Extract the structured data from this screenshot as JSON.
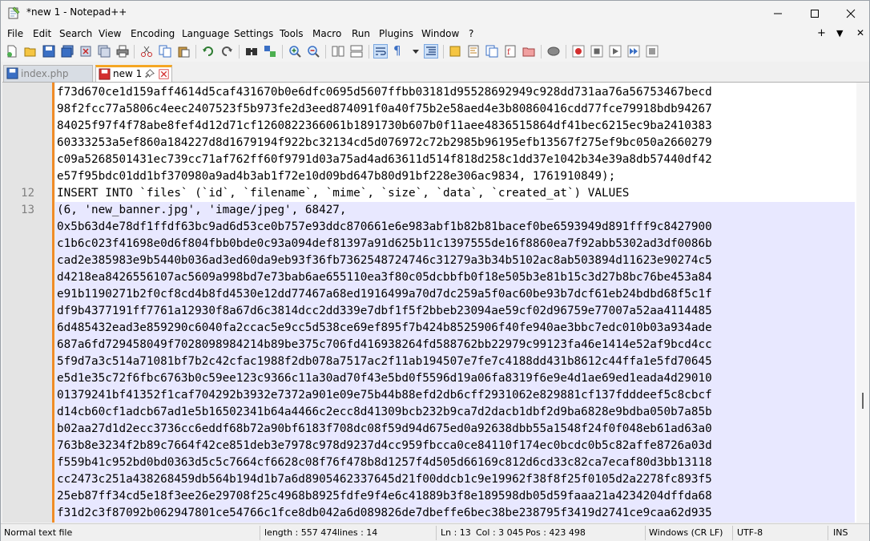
{
  "window": {
    "title": "*new 1 - Notepad++"
  },
  "menu": [
    "File",
    "Edit",
    "Search",
    "View",
    "Encoding",
    "Language",
    "Settings",
    "Tools",
    "Macro",
    "Run",
    "Plugins",
    "Window",
    "?"
  ],
  "menu_right": {
    "plus": "+",
    "down": "▼",
    "close": "✕"
  },
  "tabs": [
    {
      "label": "index.php"
    },
    {
      "label": "new 1"
    }
  ],
  "editor": {
    "lines": [
      "f73d670ce1d159aff4614d5caf431670b0e6dfc0695d5607ffbb03181d95528692949c928dd731aa76a56753467becd",
      "98f2fcc77a5806c4eec2407523f5b973fe2d3eed874091f0a40f75b2e58aed4e3b80860416cdd77fce79918bdb94267",
      "84025f97f4f78abe8fef4d12d71cf1260822366061b1891730b607b0f11aee4836515864df41bec6215ec9ba2410383",
      "60333253a5ef860a184227d8d1679194f922bc32134cd5d076972c72b2985b96195efb13567f275ef9bc050a2660279",
      "c09a5268501431ec739cc71af762ff60f9791d03a75ad4ad63611d514f818d258c1dd37e1042b34e39a8db57440df42",
      "e57f95bdc01dd1bf370980a9ad4b3ab1f72e10d09bd647b80d91bf228e306ac9834, 1761910849);",
      "INSERT INTO `files` (`id`, `filename`, `mime`, `size`, `data`, `created_at`) VALUES",
      "(6, 'new_banner.jpg', 'image/jpeg', 68427,",
      "0x5b63d4e78df1ffdf63bc9ad6d53ce0b757e93ddc870661e6e983abf1b82b81bacef0be6593949d891fff9c8427900",
      "c1b6c023f41698e0d6f804fbb0bde0c93a094def81397a91d625b11c1397555de16f8860ea7f92abb5302ad3df0086b",
      "cad2e385983e9b5440b036ad3ed60da9eb93f36fb7362548724746c31279a3b34b5102ac8ab503894d11623e90274c5",
      "d4218ea8426556107ac5609a998bd7e73bab6ae655110ea3f80c05dcbbfb0f18e505b3e81b15c3d27b8bc76be453a84",
      "e91b1190271b2f0cf8cd4b8fd4530e12dd77467a68ed1916499a70d7dc259a5f0ac60be93b7dcf61eb24bdbd68f5c1f",
      "df9b4377191ff7761a12930f8a67d6c3814dcc2dd339e7dbf1f5f2bbeb23094ae59cf02d96759e77007a52aa4114485",
      "6d485432ead3e859290c6040fa2ccac5e9cc5d538ce69ef895f7b424b8525906f40fe940ae3bbc7edc010b03a934ade",
      "687a6fd729458049f7028098984214b89be375c706fd416938264fd588762bb22979c99123fa46e1414e52af9bcd4cc",
      "5f9d7a3c514a71081bf7b2c42cfac1988f2db078a7517ac2f11ab194507e7fe7c4188dd431b8612c44ffa1e5fd70645",
      "e5d1e35c72f6fbc6763b0c59ee123c9366c11a30ad70f43e5bd0f5596d19a06fa8319f6e9e4d1ae69ed1eada4d29010",
      "01379241bf41352f1caf704292b3932e7372a901e09e75b44b88efd2db6cff2931062e829881cf137fdddeef5c8cbcf",
      "d14cb60cf1adcb67ad1e5b16502341b64a4466c2ecc8d41309bcb232b9ca7d2dacb1dbf2d9ba6828e9bdba050b7a85b",
      "b02aa27d1d2ecc3736cc6eddf68b72a90bf6183f708dc08f59d94d675ed0a92638dbb55a1548f24f0f048eb61ad63a0",
      "763b8e3234f2b89c7664f42ce851deb3e7978c978d9237d4cc959fbcca0ce84110f174ec0bcdc0b5c82affe8726a03d",
      "f559b41c952bd0bd0363d5c5c7664cf6628c08f76f478b8d1257f4d505d66169c812d6cd33c82ca7ecaf80d3bb13118",
      "cc2473c251a438268459db564b194d1b7a6d8905462337645d21f00ddcb1c9e19962f38f8f25f0105d2a2278fc893f5",
      "25eb87ff34cd5e18f3ee26e29708f25c4968b8925fdfe9f4e6c41889b3f8e189598db05d59faaa21a4234204dffda68",
      "f31d2c3f87092b062947801ce54766c1fce8db042a6d089826de7dbeffe6bec38be238795f3419d2741ce9caa62d935"
    ],
    "line_numbers": [
      {
        "row": 6,
        "num": "12"
      },
      {
        "row": 7,
        "num": "13"
      }
    ]
  },
  "status": {
    "type": "Normal text file",
    "length": "length : 557 474",
    "lines": "lines : 14",
    "ln": "Ln : 13",
    "col": "Col : 3 045",
    "pos": "Pos : 423 498",
    "eol": "Windows (CR LF)",
    "encoding": "UTF-8",
    "mode": "INS"
  }
}
